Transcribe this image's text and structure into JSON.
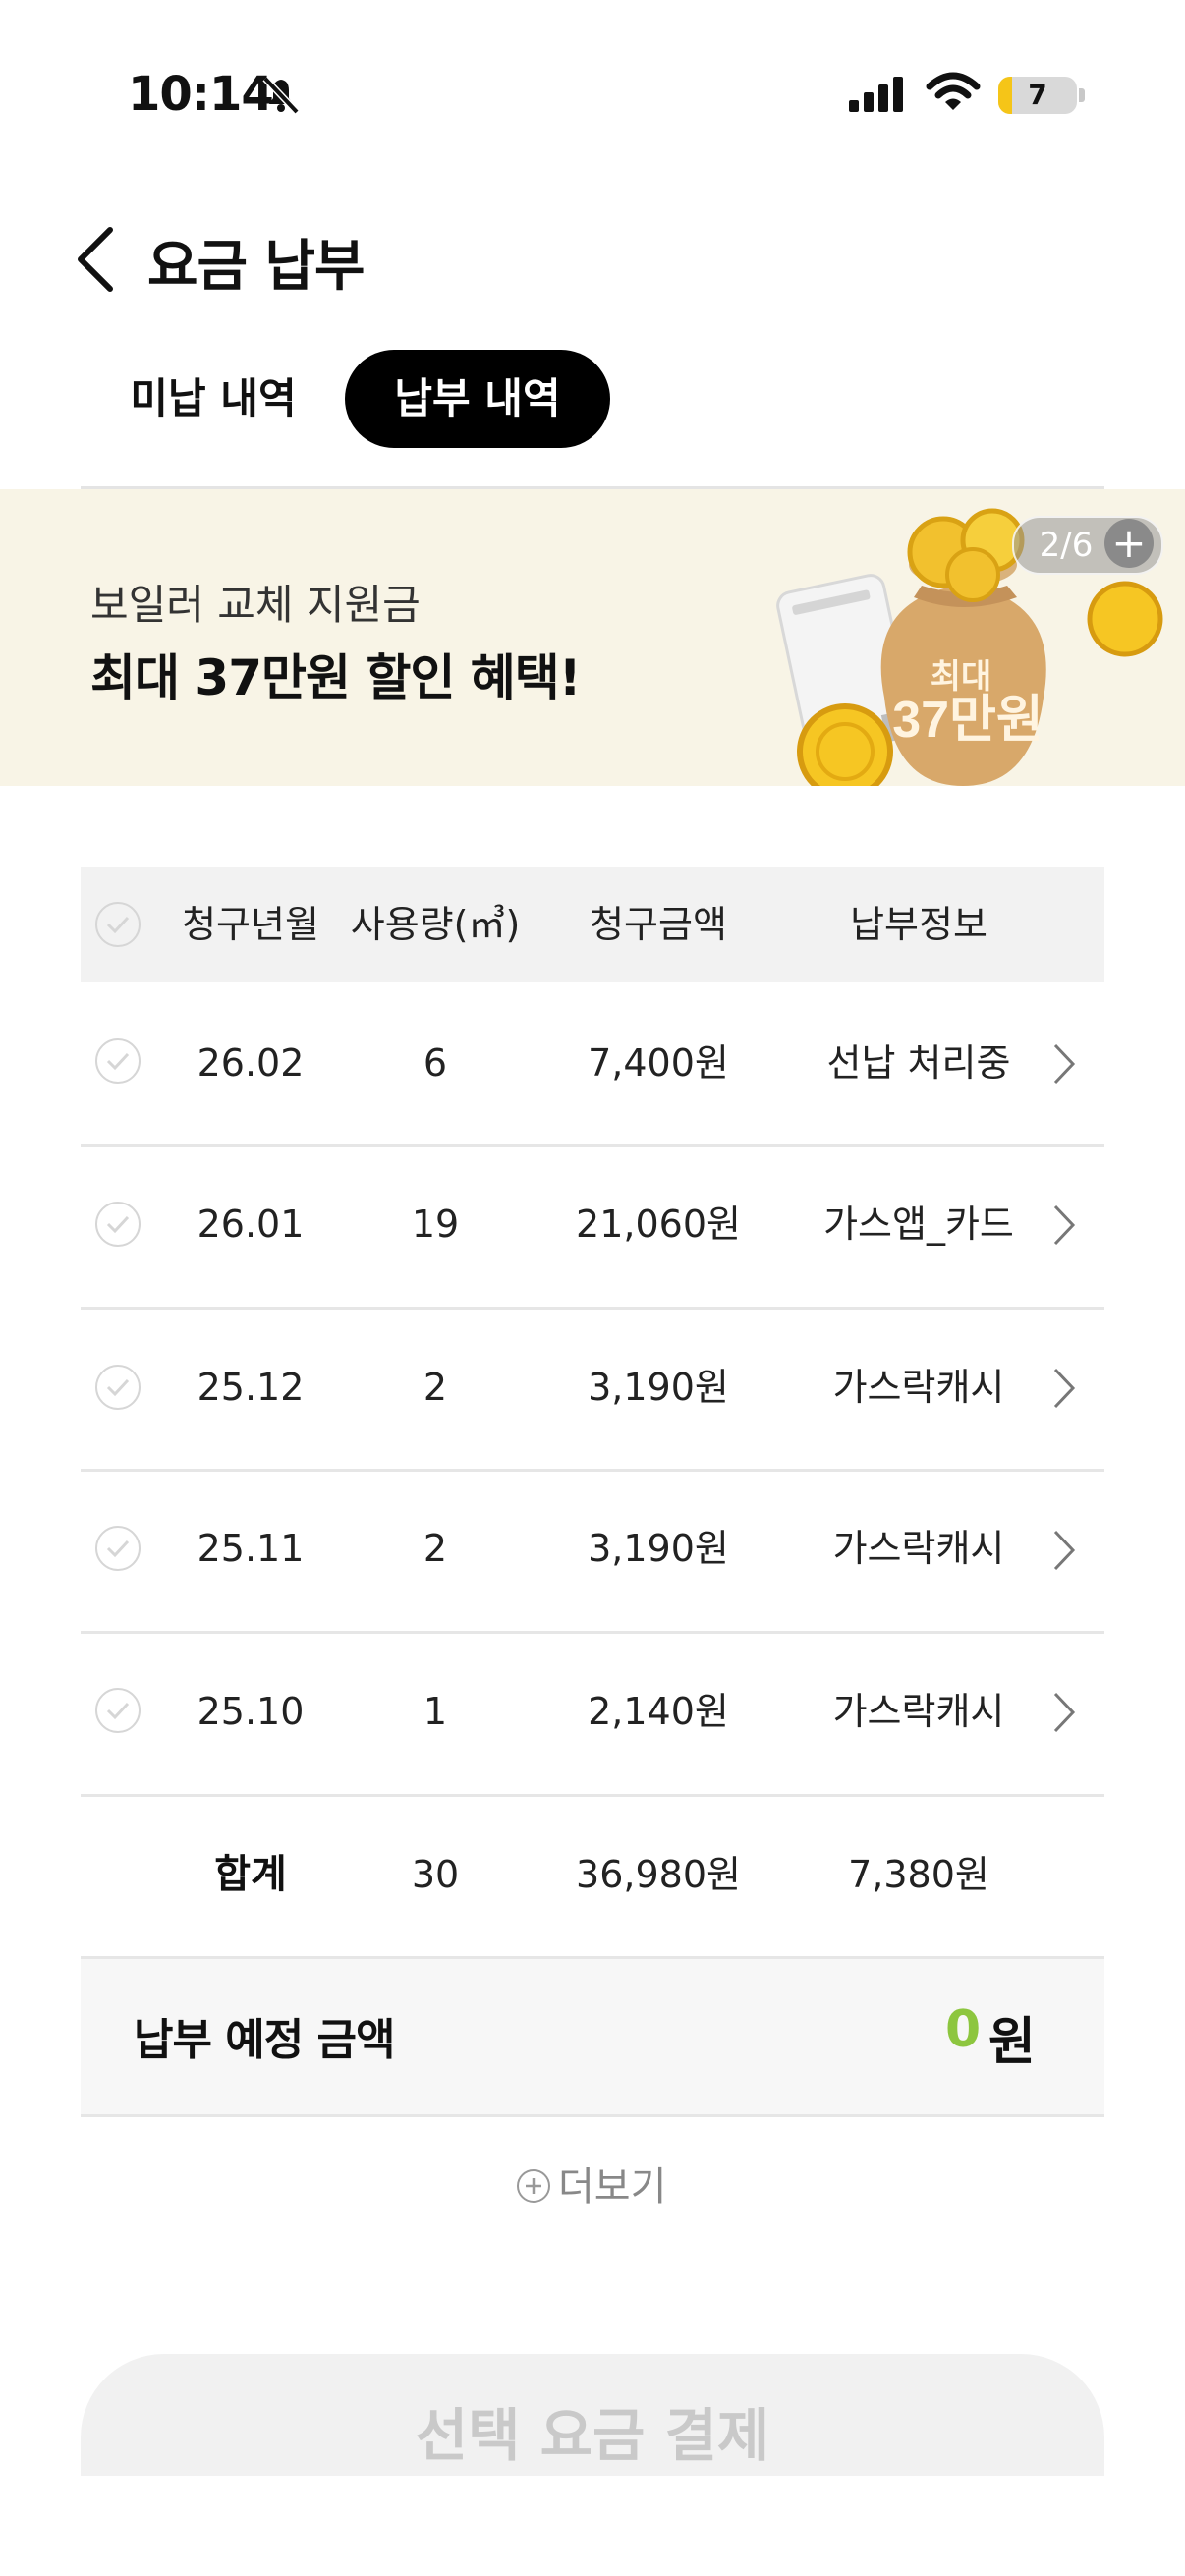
{
  "status_bar": {
    "time": "10:14",
    "battery": "7"
  },
  "header": {
    "title": "요금 납부"
  },
  "tabs": {
    "unpaid": "미납 내역",
    "paid": "납부 내역"
  },
  "banner": {
    "subtitle": "보일러 교체 지원금",
    "title": "최대 37만원 할인 혜택!",
    "badge_line1": "최대",
    "badge_line2": "37만원",
    "page_indicator": "2/6",
    "plus": "+"
  },
  "table": {
    "headers": [
      "청구년월",
      "사용량(㎥)",
      "청구금액",
      "납부정보"
    ],
    "rows": [
      {
        "month": "26.02",
        "usage": "6",
        "amount": "7,400원",
        "info": "선납 처리중"
      },
      {
        "month": "26.01",
        "usage": "19",
        "amount": "21,060원",
        "info": "가스앱_카드"
      },
      {
        "month": "25.12",
        "usage": "2",
        "amount": "3,190원",
        "info": "가스락캐시"
      },
      {
        "month": "25.11",
        "usage": "2",
        "amount": "3,190원",
        "info": "가스락캐시"
      },
      {
        "month": "25.10",
        "usage": "1",
        "amount": "2,140원",
        "info": "가스락캐시"
      }
    ],
    "total": {
      "label": "합계",
      "usage": "30",
      "amount": "36,980원",
      "info": "7,380원"
    }
  },
  "scheduled": {
    "label": "납부 예정 금액",
    "amount": "0",
    "unit": "원"
  },
  "more": "더보기",
  "pay_button": "선택 요금 결제",
  "colors": {
    "accent_green": "#8dc63f",
    "banner_bg": "#f8f4e6",
    "tab_active_bg": "#000000"
  }
}
